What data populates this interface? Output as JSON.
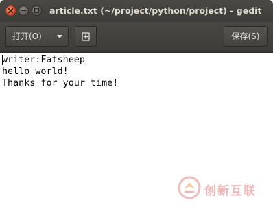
{
  "window": {
    "title": "article.txt (~/project/python/project) - gedit"
  },
  "toolbar": {
    "open_label": "打开(O)",
    "new_tab_icon": "new-document-icon",
    "save_label": "保存(S)"
  },
  "editor": {
    "lines": [
      "writer:Fatsheep",
      "hello world!",
      "Thanks for your time!"
    ]
  },
  "watermark": {
    "text": "创新互联"
  },
  "colors": {
    "titlebar": "#3c3b37",
    "toolbar": "#44433f",
    "close_button": "#e2532d",
    "watermark": "#e67878"
  }
}
